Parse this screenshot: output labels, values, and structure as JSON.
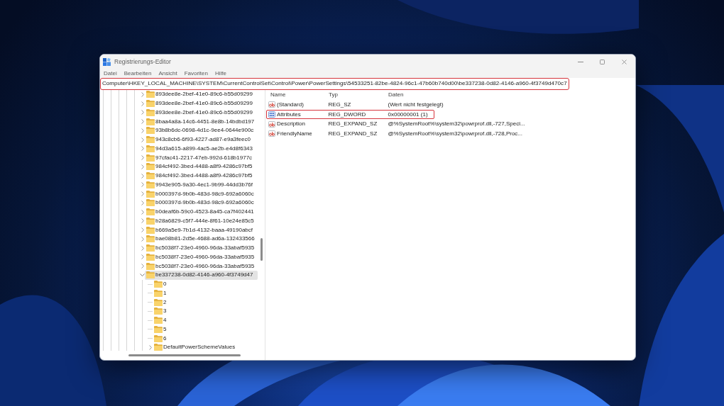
{
  "window": {
    "title": "Registrierungs-Editor"
  },
  "menu": [
    "Datei",
    "Bearbeiten",
    "Ansicht",
    "Favoriten",
    "Hilfe"
  ],
  "address_bar": {
    "value": "Computer\\HKEY_LOCAL_MACHINE\\SYSTEM\\CurrentControlSet\\Control\\Power\\PowerSettings\\54533251-82be-4824-96c1-47b60b740d00\\be337238-0d82-4146-a960-4f3749d470c7",
    "highlighted": true
  },
  "tree": {
    "items": [
      {
        "label": "893dee8e-2bef-41e0-89c6-b55d09299",
        "expanded": false,
        "selected": false
      },
      {
        "label": "893dee8e-2bef-41e0-89c6-b55d09299",
        "expanded": false,
        "selected": false
      },
      {
        "label": "893dee8e-2bef-41e0-89c6-b55d09299",
        "expanded": false,
        "selected": false
      },
      {
        "label": "8baa4a8a-14c6-4451-8e8b-14bdbd197",
        "expanded": false,
        "selected": false
      },
      {
        "label": "93b8b6dc-0698-4d1c-9ee4-0644e900c",
        "expanded": false,
        "selected": false
      },
      {
        "label": "943c8cb6-6f93-4227-ad87-e9a3feec0",
        "expanded": false,
        "selected": false
      },
      {
        "label": "94d3a615-a899-4ac5-ae2b-e4d8f6343",
        "expanded": false,
        "selected": false
      },
      {
        "label": "97cfac41-2217-47eb-992d-618b1977c",
        "expanded": false,
        "selected": false
      },
      {
        "label": "984cf492-3bed-4488-a8f9-4286c97bf5",
        "expanded": false,
        "selected": false
      },
      {
        "label": "984cf492-3bed-4488-a8f9-4286c97bf5",
        "expanded": false,
        "selected": false
      },
      {
        "label": "9943e905-9a30-4ec1-9b99-44dd3b76f",
        "expanded": false,
        "selected": false
      },
      {
        "label": "b000397d-9b0b-483d-98c9-692a6060c",
        "expanded": false,
        "selected": false
      },
      {
        "label": "b000397d-9b0b-483d-98c9-692a6060c",
        "expanded": false,
        "selected": false
      },
      {
        "label": "b0deaf6b-59c0-4523-8a45-ca7f402441",
        "expanded": false,
        "selected": false
      },
      {
        "label": "b28a6829-c5f7-444e-8f61-10e24e85c5",
        "expanded": false,
        "selected": false
      },
      {
        "label": "b669a5e9-7b1d-4132-baaa-49190abcf",
        "expanded": false,
        "selected": false
      },
      {
        "label": "bae08b81-2d5e-4688-ad6a-132433566",
        "expanded": false,
        "selected": false
      },
      {
        "label": "bc5038f7-23e0-4960-96da-33abaf5935",
        "expanded": false,
        "selected": false
      },
      {
        "label": "bc5038f7-23e0-4960-96da-33abaf5935",
        "expanded": false,
        "selected": false
      },
      {
        "label": "bc5038f7-23e0-4960-96da-33abaf5935",
        "expanded": false,
        "selected": false
      },
      {
        "label": "be337238-0d82-4146-a960-4f3749d47",
        "expanded": true,
        "selected": true,
        "children": [
          {
            "label": "0",
            "selected": false
          },
          {
            "label": "1",
            "selected": false
          },
          {
            "label": "2",
            "selected": false
          },
          {
            "label": "3",
            "selected": false
          },
          {
            "label": "4",
            "selected": false
          },
          {
            "label": "5",
            "selected": false
          },
          {
            "label": "6",
            "selected": false
          },
          {
            "label": "DefaultPowerSchemeValues",
            "expanded": false,
            "selected": false
          }
        ]
      }
    ]
  },
  "values": {
    "columns": [
      "Name",
      "Typ",
      "Daten"
    ],
    "rows": [
      {
        "kind": "string",
        "name": "(Standard)",
        "type": "REG_SZ",
        "data": "(Wert nicht festgelegt)",
        "selected": false,
        "highlighted": false
      },
      {
        "kind": "dword",
        "name": "Attributes",
        "type": "REG_DWORD",
        "data": "0x00000001 (1)",
        "selected": false,
        "highlighted": true
      },
      {
        "kind": "string",
        "name": "Description",
        "type": "REG_EXPAND_SZ",
        "data": "@%SystemRoot%\\system32\\powrprof.dll,-727,Speci...",
        "selected": false,
        "highlighted": false
      },
      {
        "kind": "string",
        "name": "FriendlyName",
        "type": "REG_EXPAND_SZ",
        "data": "@%SystemRoot%\\system32\\powrprof.dll,-728,Proc...",
        "selected": false,
        "highlighted": false
      }
    ]
  }
}
